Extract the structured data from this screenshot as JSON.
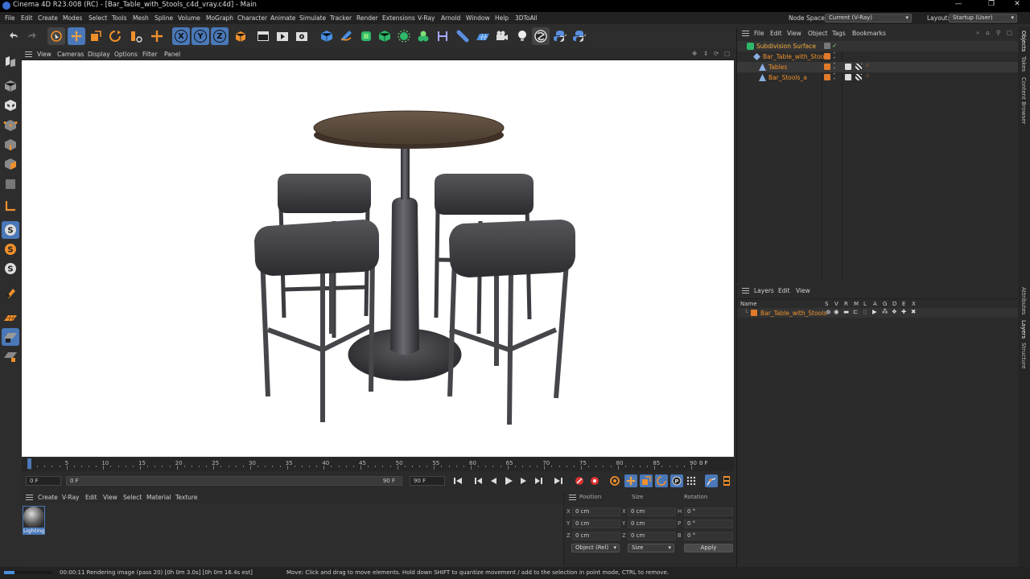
{
  "titlebar": {
    "title": "Cinema 4D R23.008 (RC) - [Bar_Table_with_Stools_c4d_vray.c4d] - Main",
    "minimize": "—",
    "maximize": "❐",
    "close": "✕"
  },
  "menubar": {
    "items": [
      "File",
      "Edit",
      "Create",
      "Modes",
      "Select",
      "Tools",
      "Mesh",
      "Spline",
      "Volume",
      "MoGraph",
      "Character",
      "Animate",
      "Simulate",
      "Tracker",
      "Render",
      "Extensions",
      "V-Ray",
      "Arnold",
      "Window",
      "Help",
      "3DToAll"
    ],
    "node_space_label": "Node Space:",
    "node_space_value": "Current (V-Ray)",
    "layout_label": "Layout:",
    "layout_value": "Startup (User)"
  },
  "toolbar": {
    "axis_x": "X",
    "axis_y": "Y",
    "axis_z": "Z"
  },
  "viewport_menu": {
    "items": [
      "View",
      "Cameras",
      "Display",
      "Options",
      "Filter",
      "Panel"
    ]
  },
  "timeline": {
    "ticks": [
      "0",
      "5",
      "10",
      "15",
      "20",
      "25",
      "30",
      "35",
      "40",
      "45",
      "50",
      "55",
      "60",
      "65",
      "70",
      "75",
      "80",
      "85",
      "90"
    ],
    "current_frame": "0 F"
  },
  "transport": {
    "start_frame": "0 F",
    "range_start": "0 F",
    "range_end": "90 F",
    "end_frame": "90 F"
  },
  "material_manager": {
    "menu": [
      "Create",
      "V-Ray",
      "Edit",
      "View",
      "Select",
      "Material",
      "Texture"
    ],
    "materials": [
      {
        "name": "Lighting"
      }
    ]
  },
  "coordinates": {
    "headers": {
      "position": "Position",
      "size": "Size",
      "rotation": "Rotation"
    },
    "rows": [
      {
        "axis": "X",
        "pos": "0 cm",
        "size_axis": "X",
        "size": "0 cm",
        "rot_axis": "H",
        "rot": "0 °"
      },
      {
        "axis": "Y",
        "pos": "0 cm",
        "size_axis": "Y",
        "size": "0 cm",
        "rot_axis": "P",
        "rot": "0 °"
      },
      {
        "axis": "Z",
        "pos": "0 cm",
        "size_axis": "Z",
        "size": "0 cm",
        "rot_axis": "B",
        "rot": "0 °"
      }
    ],
    "mode": "Object (Rel)",
    "size_mode": "Size",
    "apply": "Apply"
  },
  "object_manager": {
    "menu": [
      "File",
      "Edit",
      "View",
      "Object",
      "Tags",
      "Bookmarks"
    ],
    "objects": [
      {
        "name": "Subdivision Surface"
      },
      {
        "name": "Bar_Table_with_Stools"
      },
      {
        "name": "Tables"
      },
      {
        "name": "Bar_Stools_a"
      }
    ]
  },
  "layer_manager": {
    "menu": [
      "Layers",
      "Edit",
      "View"
    ],
    "name_header": "Name",
    "columns": [
      "S",
      "V",
      "R",
      "M",
      "L",
      "A",
      "G",
      "D",
      "E",
      "X"
    ],
    "layers": [
      {
        "name": "Bar_Table_with_Stools",
        "color": "#e07a2a"
      }
    ]
  },
  "side_tabs": [
    "Objects",
    "Takes",
    "Content Browser",
    "Attributes",
    "Layers",
    "Structure"
  ],
  "statusbar": {
    "render_progress": 0.22,
    "render_text": "00:00:11 Rendering image (pass 20) [0h  0m  3.0s] [0h  0m  16.4s est]",
    "hint": "Move: Click and drag to move elements. Hold down SHIFT to quantize movement / add to the selection in point mode, CTRL to remove."
  },
  "colors": {
    "accent_orange": "#f0902c",
    "active_blue": "#4a78b8",
    "object_green": "#7ee07a"
  }
}
